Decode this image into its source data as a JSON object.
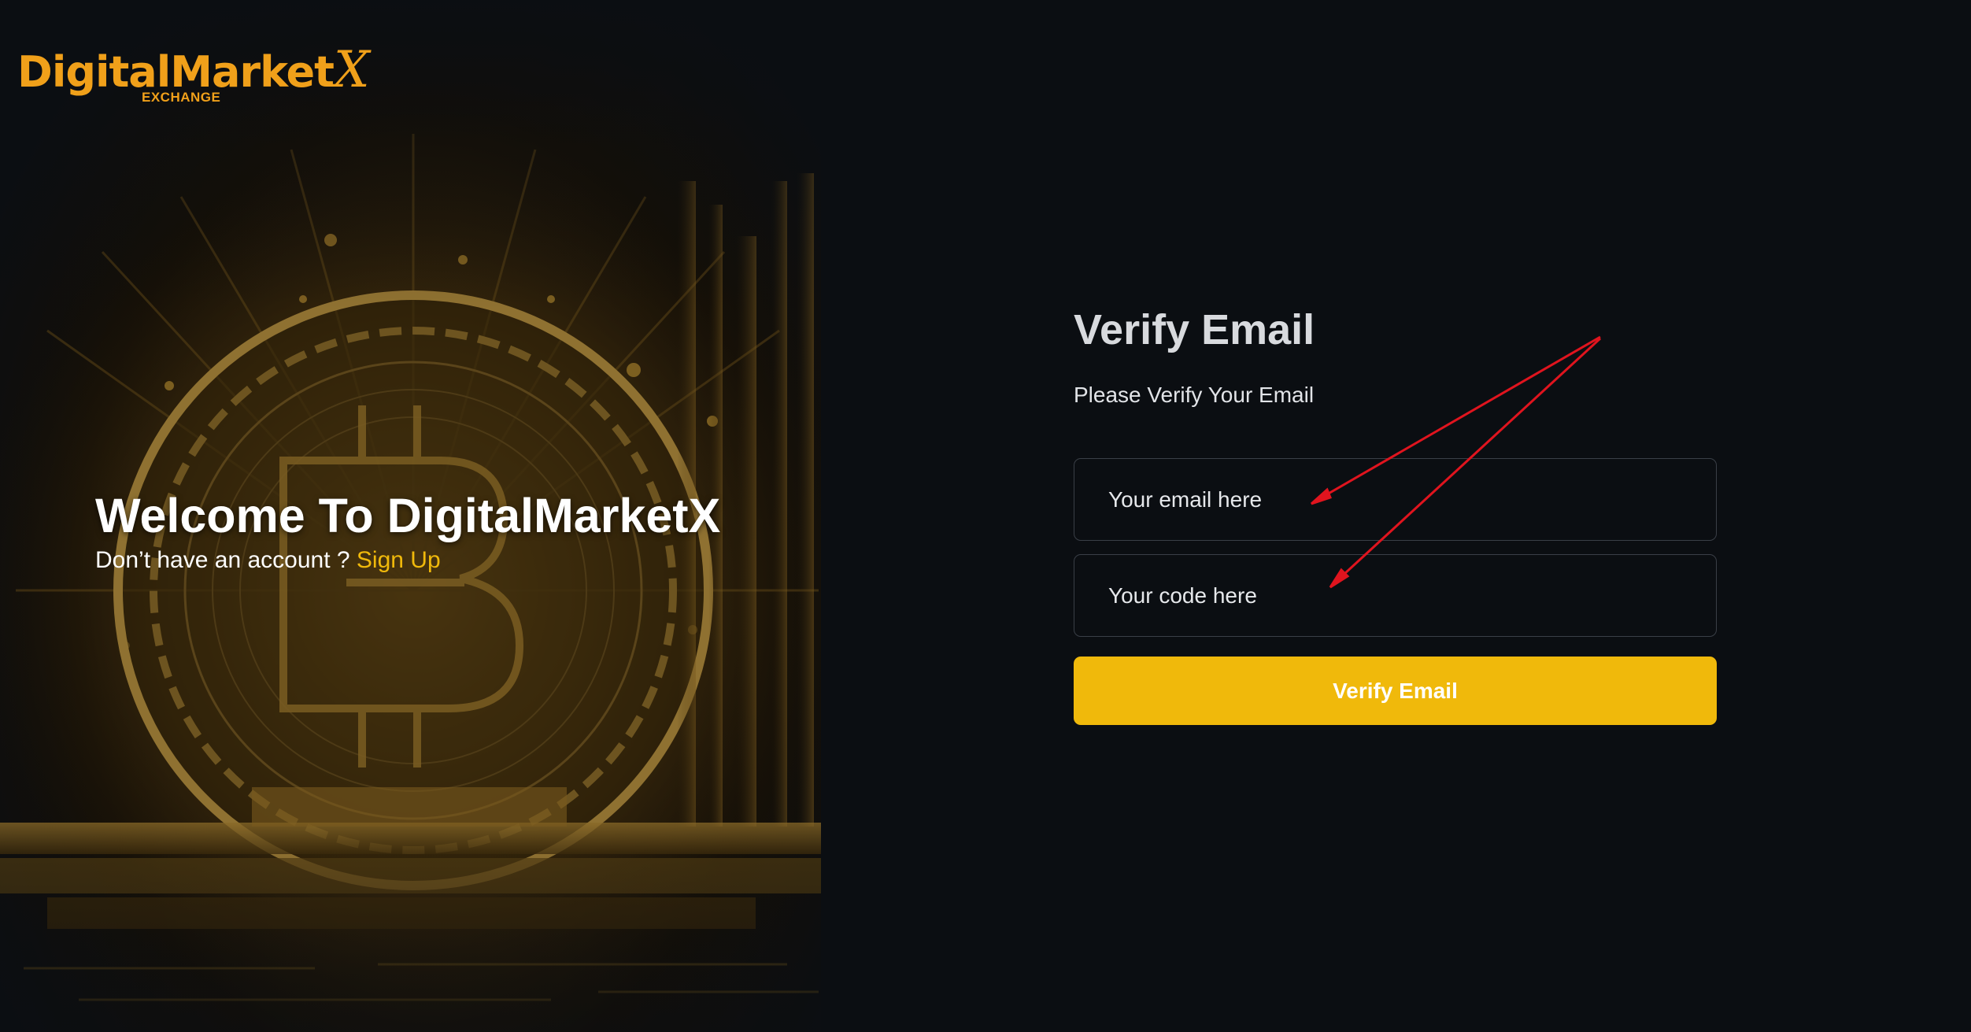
{
  "brand": {
    "name": "DigitalMarket",
    "name_x": "X",
    "tagline": "EXCHANGE"
  },
  "hero": {
    "title": "Welcome To DigitalMarketX",
    "prompt": "Don’t have an account ?",
    "signup_label": "Sign Up"
  },
  "form": {
    "title": "Verify Email",
    "subtitle": "Please Verify Your Email",
    "email_placeholder": "Your email here",
    "code_placeholder": "Your code here",
    "submit_label": "Verify Email"
  },
  "colors": {
    "accent": "#f0b90b",
    "logo": "#f0a01a",
    "background": "#0b0e12",
    "annotation_arrow": "#e0141e"
  },
  "icons": {
    "hero_image": "bitcoin-coin-illustration"
  }
}
